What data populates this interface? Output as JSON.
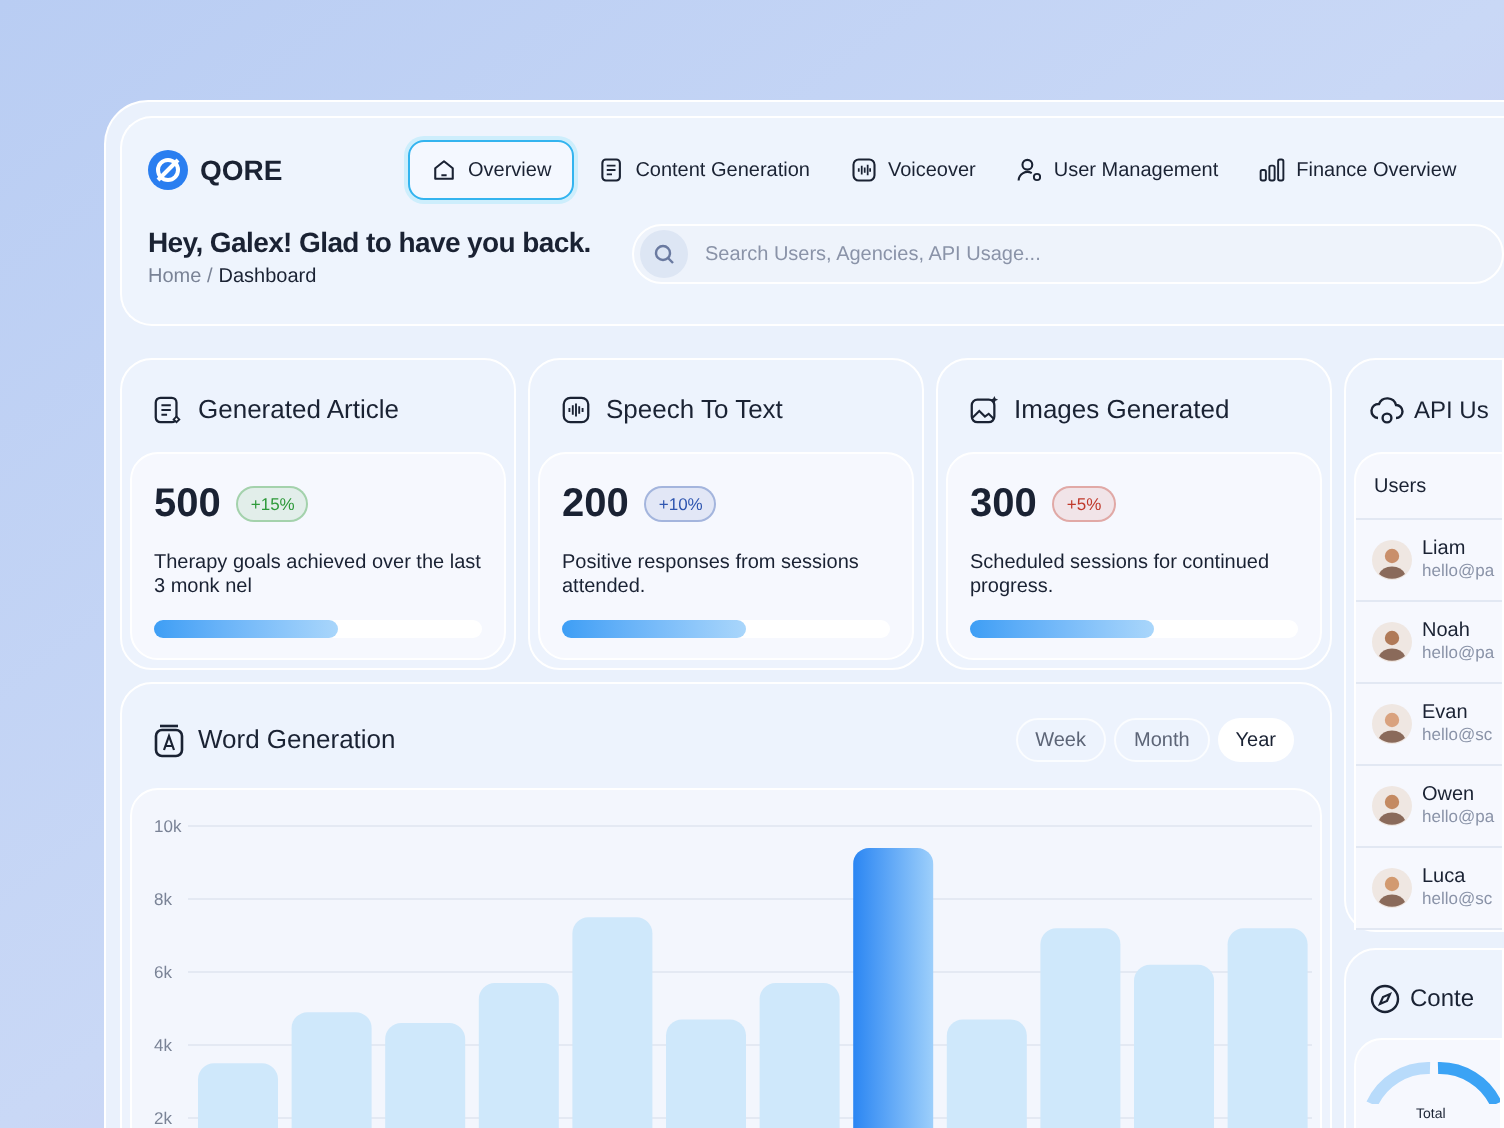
{
  "brand": {
    "name": "QORE"
  },
  "nav": [
    {
      "label": "Overview",
      "selected": true
    },
    {
      "label": "Content Generation",
      "selected": false
    },
    {
      "label": "Voiceover",
      "selected": false
    },
    {
      "label": "User Management",
      "selected": false
    },
    {
      "label": "Finance Overview",
      "selected": false
    }
  ],
  "greeting": "Hey, Galex! Glad to have you back.",
  "breadcrumb": {
    "parent": "Home /",
    "current": "Dashboard"
  },
  "search": {
    "placeholder": "Search Users, Agencies, API Usage..."
  },
  "stat_cards": [
    {
      "title": "Generated Article",
      "value": "500",
      "badge": "+15%",
      "color": "#2e9a3a",
      "description": "Therapy goals achieved over the last 3 monk nel",
      "level": 0.56
    },
    {
      "title": "Speech To Text",
      "value": "200",
      "badge": "+10%",
      "color": "#2f56b0",
      "description": "Positive responses from sessions attended.",
      "level": 0.56
    },
    {
      "title": "Images Generated",
      "value": "300",
      "badge": "+5%",
      "color": "#c0392b",
      "description": "Scheduled sessions for continued progress.",
      "level": 0.56
    }
  ],
  "word_generation": {
    "title": "Word Generation",
    "periods": [
      {
        "label": "Week",
        "selected": false
      },
      {
        "label": "Month",
        "selected": false
      },
      {
        "label": "Year",
        "selected": true
      }
    ],
    "chart_data": {
      "type": "bar",
      "stacked": true,
      "grid": true,
      "ylim": [
        0,
        10000
      ],
      "yticks": [
        {
          "value": 2000,
          "label": "2k"
        },
        {
          "value": 4000,
          "label": "4k"
        },
        {
          "value": 6000,
          "label": "6k"
        },
        {
          "value": 8000,
          "label": "8k"
        },
        {
          "value": 10000,
          "label": "10k"
        }
      ],
      "series": [
        {
          "color": "#cfe8fb",
          "values": [
            3500,
            4900,
            4600,
            5700,
            7500,
            4700,
            5700,
            null,
            4700,
            7200,
            6200,
            7200
          ]
        },
        {
          "color": "#3b8ff5",
          "values": [
            null,
            null,
            null,
            null,
            null,
            null,
            null,
            9400,
            null,
            null,
            null,
            null
          ]
        }
      ]
    }
  },
  "api_usage": {
    "title": "API Us",
    "column": "Users",
    "users": [
      {
        "name": "Liam",
        "email": "hello@pa"
      },
      {
        "name": "Noah",
        "email": "hello@pa"
      },
      {
        "name": "Evan",
        "email": "hello@sc"
      },
      {
        "name": "Owen",
        "email": "hello@pa"
      },
      {
        "name": "Luca",
        "email": "hello@sc"
      }
    ]
  },
  "content": {
    "title": "Conte",
    "donut_label": "Total"
  }
}
